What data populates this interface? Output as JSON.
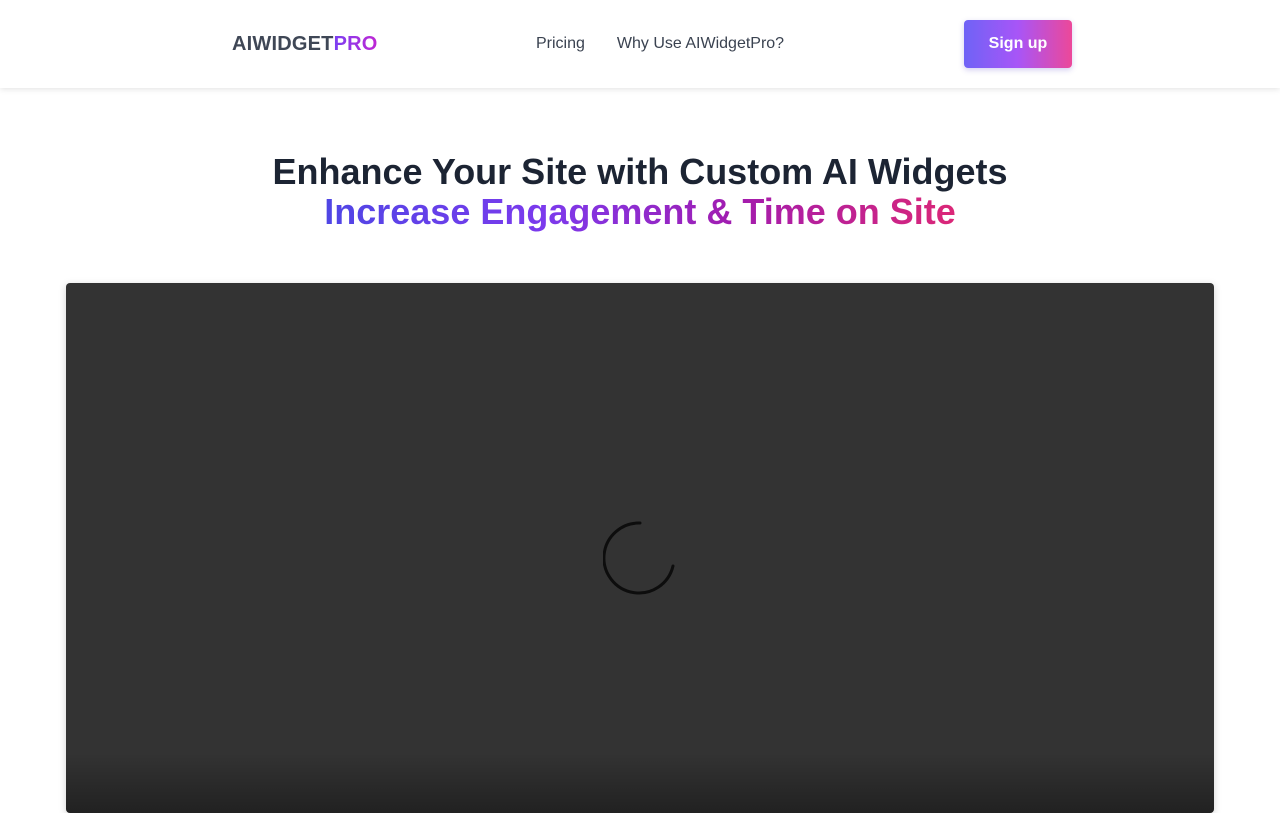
{
  "header": {
    "logo_main": "AIWIDGET",
    "logo_accent": "PRO",
    "nav": [
      {
        "label": "Pricing"
      },
      {
        "label": "Why Use AIWidgetPro?"
      }
    ],
    "signup_label": "Sign up"
  },
  "hero": {
    "title": "Enhance Your Site with Custom AI Widgets",
    "subtitle": "Increase Engagement & Time on Site"
  },
  "video": {
    "state": "loading",
    "spinner_icon": "loading-spinner-icon"
  },
  "colors": {
    "brand_text": "#3f4756",
    "accent_start": "#4f46e5",
    "accent_mid": "#a21caf",
    "accent_end": "#db2777",
    "video_background": "#333333"
  }
}
